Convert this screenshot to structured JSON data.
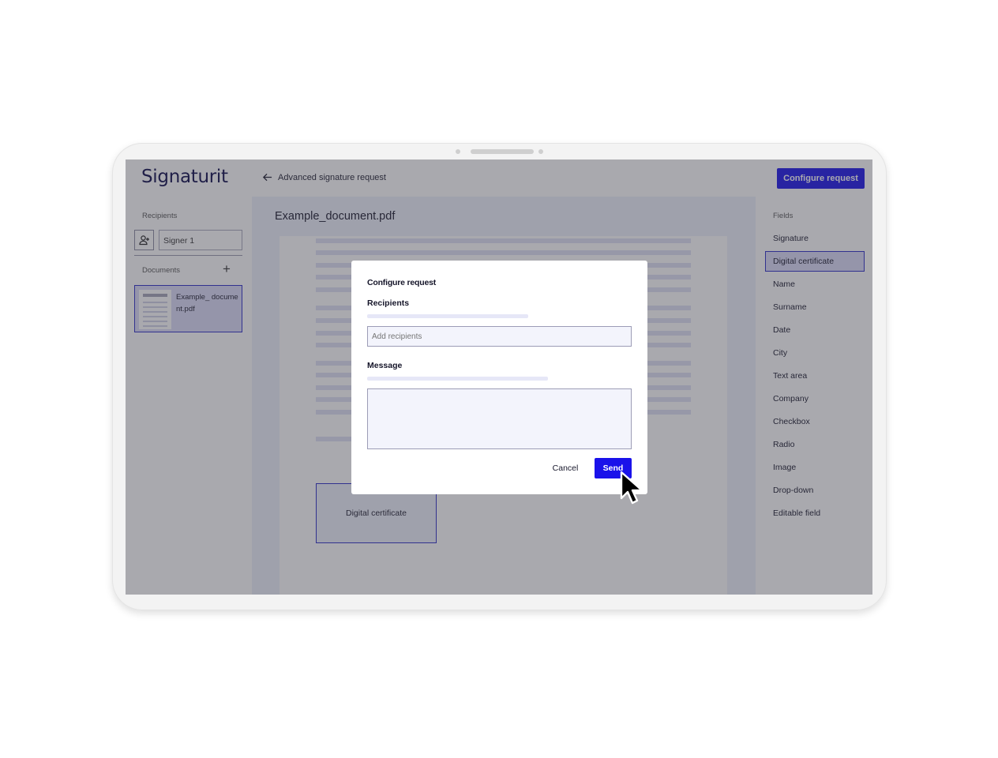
{
  "header": {
    "logo": "Signaturit",
    "back_label": "Advanced signature request",
    "configure_button": "Configure request"
  },
  "sidebar_left": {
    "recipients_label": "Recipients",
    "signer_value": "Signer 1",
    "documents_label": "Documents",
    "document_name": "Example_ document.pdf"
  },
  "main": {
    "document_title": "Example_document.pdf",
    "placed_field_label": "Digital certificate"
  },
  "sidebar_right": {
    "fields_label": "Fields",
    "items": [
      "Signature",
      "Digital certificate",
      "Name",
      "Surname",
      "Date",
      "City",
      "Text area",
      "Company",
      "Checkbox",
      "Radio",
      "Image",
      "Drop-down",
      "Editable field"
    ],
    "selected_item": "Digital certificate"
  },
  "modal": {
    "title": "Configure request",
    "recipients_label": "Recipients",
    "recipients_placeholder": "Add recipients",
    "message_label": "Message",
    "message_value": "",
    "cancel_label": "Cancel",
    "send_label": "Send"
  },
  "colors": {
    "accent": "#1a12ea",
    "logo": "#0c0a4a",
    "selected_bg": "#dcdcf8",
    "overlay": "#3c3c46"
  }
}
